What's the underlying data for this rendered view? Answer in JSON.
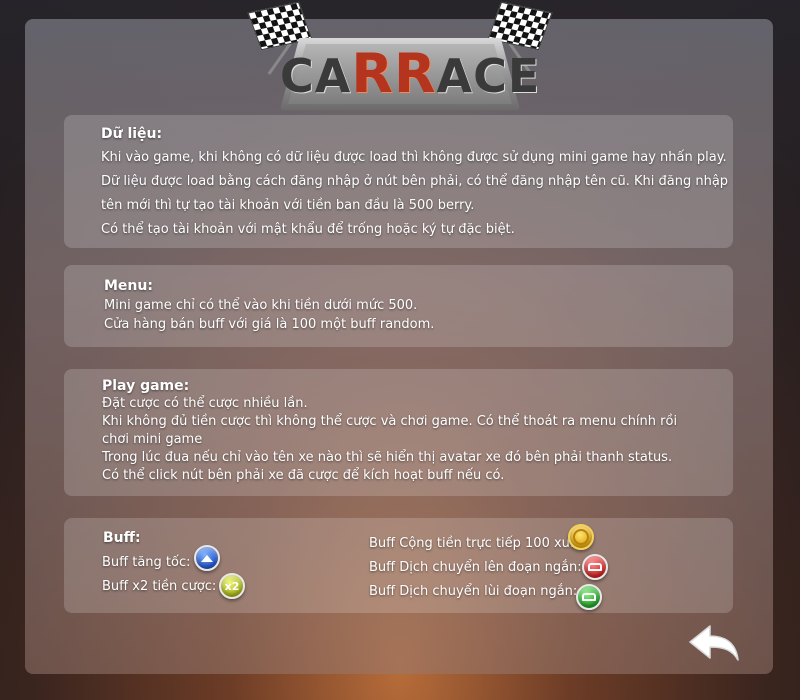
{
  "logo": {
    "part1": "CA",
    "part2": "RR",
    "part3": "ACE"
  },
  "sections": {
    "data": {
      "title": "Dữ liệu:",
      "lines": [
        "Khi vào game, khi không có dữ liệu được load thì không được sử dụng mini game hay nhấn play.",
        "Dữ liệu được load bằng cách đăng nhập ở nút bên phải, có thể đăng nhập tên cũ. Khi đăng nhập",
        "tên mới thì tự tạo tài khoản với tiền ban đầu là 500 berry.",
        "Có thể tạo tài khoản với mật khẩu để trống hoặc ký tự đặc biệt."
      ]
    },
    "menu": {
      "title": "Menu:",
      "lines": [
        "Mini game chỉ có thể vào khi tiền dưới mức 500.",
        "Cửa hàng bán buff với giá là 100 một buff random."
      ]
    },
    "play": {
      "title": "Play game:",
      "lines": [
        "Đặt cược có thể cược nhiều lần.",
        "Khi không đủ tiền cược thì không thể cược và chơi game. Có thể thoát ra menu chính rồi chơi mini game",
        "Trong lúc đua nếu chỉ vào tên xe nào thì sẽ hiển thị avatar xe đó bên phải thanh status.",
        "Có thể click nút bên phải xe đã cược để kích hoạt buff nếu có."
      ]
    },
    "buff": {
      "title": "Buff:",
      "items": [
        {
          "label": "Buff tăng tốc:",
          "icon": "speed-up-icon"
        },
        {
          "label": "Buff x2 tiền cược:",
          "icon": "x2-icon",
          "badge_text": "x2"
        },
        {
          "label": "Buff Cộng tiền trực tiếp 100 xu:",
          "icon": "coin-icon"
        },
        {
          "label": "Buff Dịch chuyển lên đoạn ngắn:",
          "icon": "teleport-forward-icon"
        },
        {
          "label": "Buff Dịch chuyển lùi đoạn ngắn:",
          "icon": "teleport-back-icon"
        }
      ]
    }
  },
  "back_button": {
    "icon": "back-arrow-icon"
  }
}
